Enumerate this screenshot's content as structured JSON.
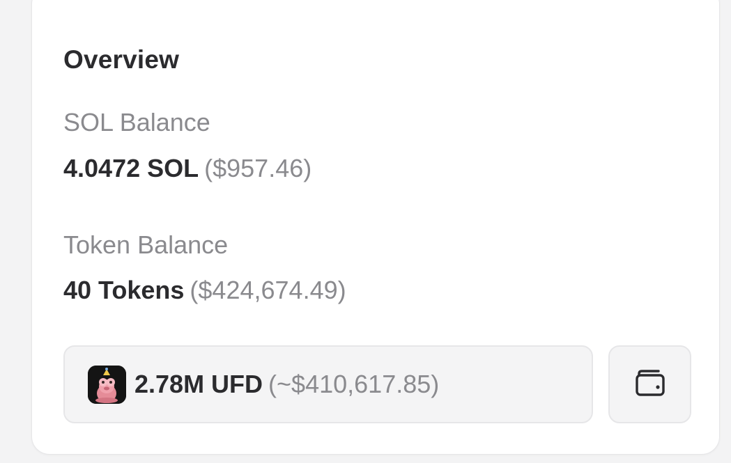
{
  "overview": {
    "title": "Overview",
    "sol": {
      "label": "SOL Balance",
      "amount": "4.0472 SOL",
      "usd": "($957.46)"
    },
    "tokens": {
      "label": "Token Balance",
      "amount": "40 Tokens",
      "usd": "($424,674.49)"
    },
    "top_token": {
      "amount": "2.78M UFD",
      "usd": "(~$410,617.85)",
      "icon": "token-logo"
    },
    "wallet_button": {
      "icon": "wallet-icon"
    }
  }
}
